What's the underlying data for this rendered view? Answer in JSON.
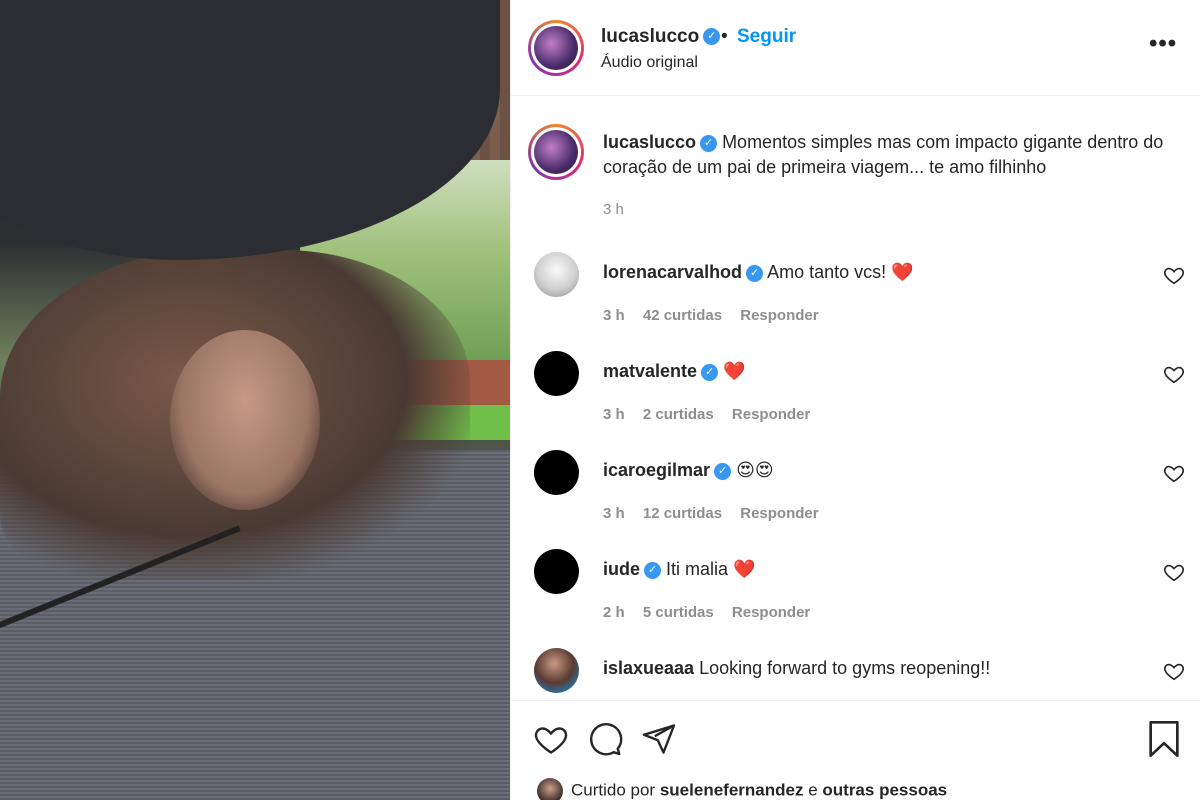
{
  "post": {
    "username": "lucaslucco",
    "follow_label": "Seguir",
    "separator": "•",
    "audio": "Áudio original",
    "more": "•••"
  },
  "caption": {
    "username": "lucaslucco",
    "text": "Momentos simples mas com impacto gigante dentro do coração de um pai de primeira viagem... te amo filhinho",
    "time": "3 h"
  },
  "comments": [
    {
      "username": "lorenacarvalhod",
      "verified": true,
      "text": "Amo tanto vcs! ❤️",
      "time": "3 h",
      "likes": "42 curtidas",
      "reply": "Responder"
    },
    {
      "username": "matvalente",
      "verified": true,
      "text": "❤️",
      "time": "3 h",
      "likes": "2 curtidas",
      "reply": "Responder"
    },
    {
      "username": "icaroegilmar",
      "verified": true,
      "text": "😍😍",
      "time": "3 h",
      "likes": "12 curtidas",
      "reply": "Responder"
    },
    {
      "username": "iude",
      "verified": true,
      "text": "Iti malia ❤️",
      "time": "2 h",
      "likes": "5 curtidas",
      "reply": "Responder"
    },
    {
      "username": "islaxueaaa",
      "verified": false,
      "text": "Looking forward to gyms reopening!!",
      "time": "",
      "likes": "",
      "reply": ""
    }
  ],
  "liked_by": {
    "prefix": "Curtido por",
    "user": "suelenefernandez",
    "joiner": "e",
    "others": "outras pessoas"
  },
  "icons": {
    "verified": "✓",
    "like": "heart-icon",
    "comment": "comment-icon",
    "share": "share-icon",
    "save": "bookmark-icon"
  },
  "colors": {
    "accent": "#0095f6",
    "verified": "#3897f0",
    "muted": "#8e8e8e",
    "text": "#262626"
  }
}
